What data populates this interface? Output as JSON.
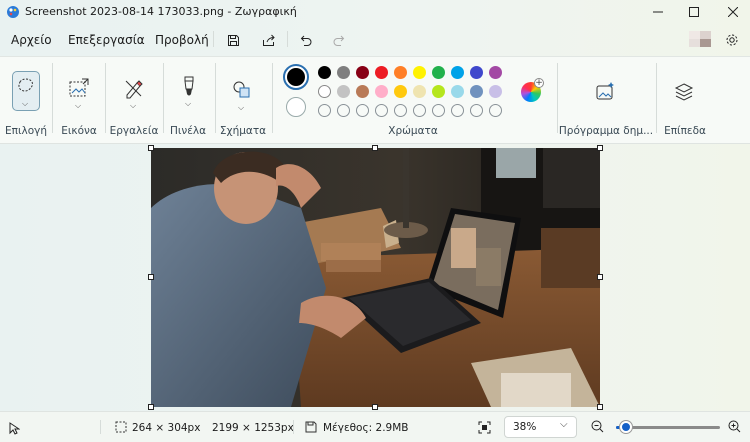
{
  "window": {
    "title": "Screenshot 2023-08-14 173033.png - Ζωγραφική"
  },
  "menu": {
    "file": "Αρχείο",
    "edit": "Επεξεργασία",
    "view": "Προβολή"
  },
  "ribbon": {
    "selection": "Επιλογή",
    "image": "Εικόνα",
    "tools": "Εργαλεία",
    "brushes": "Πινέλα",
    "shapes": "Σχήματα",
    "colors": "Χρώματα",
    "cocreator": "Πρόγραμμα δημ...",
    "layers": "Επίπεδα",
    "primary_color": "#000000",
    "secondary_color": "#ffffff",
    "palette_row1": [
      "#000000",
      "#7f7f7f",
      "#880015",
      "#ed1c24",
      "#ff7f27",
      "#fff200",
      "#22b14c",
      "#00a2e8",
      "#3f48cc",
      "#a349a4"
    ],
    "palette_row2": [
      "#ffffff",
      "#c3c3c3",
      "#b97a57",
      "#ffaec9",
      "#ffc90e",
      "#efe4b0",
      "#b5e61d",
      "#99d9ea",
      "#7092be",
      "#c8bfe7"
    ]
  },
  "status": {
    "selection_size": "264 × 304px",
    "image_size": "2199 × 1253px",
    "file_size": "Μέγεθος: 2.9MB",
    "zoom": "38%",
    "zoom_level": 0.38
  }
}
